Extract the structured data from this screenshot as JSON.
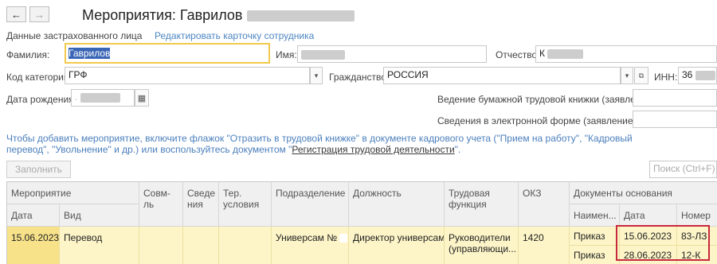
{
  "window": {
    "title": "Мероприятия: Гаврилов"
  },
  "nav": {
    "back": "←",
    "forward": "→"
  },
  "section": {
    "insured_label": "Данные застрахованного лица",
    "edit_link": "Редактировать карточку сотрудника"
  },
  "form": {
    "surname_label": "Фамилия:",
    "surname_value": "Гаврилов",
    "name_label": "Имя:",
    "patronymic_label": "Отчество:",
    "patronymic_value": "К",
    "category_label": "Код категории:",
    "category_value": "ГРФ",
    "citizenship_label": "Гражданство:",
    "citizenship_value": "РОССИЯ",
    "inn_label": "ИНН:",
    "inn_value": "36",
    "birth_label": "Дата рождения:",
    "paper_book_label": "Ведение бумажной трудовой книжки (заявление):",
    "electronic_label": "Сведения в электронной форме (заявление):"
  },
  "info": {
    "text": "Чтобы добавить мероприятие, включите флажок \"Отразить в трудовой книжке\" в документе кадрового учета (\"Прием на работу\", \"Кадровый перевод\", \"Увольнение\" и др.) или воспользуйтесь документом \"",
    "link": "Регистрация трудовой деятельности",
    "tail": "\"."
  },
  "toolbar": {
    "fill_button": "Заполнить",
    "search_placeholder": "Поиск (Ctrl+F)"
  },
  "table": {
    "headers": {
      "event": "Мероприятие",
      "date": "Дата",
      "kind": "Вид",
      "combined": "Совм-ль",
      "info": "Сведе ния",
      "lost": "Тер. условия",
      "division": "Подразделение",
      "position": "Должность",
      "function": "Трудовая функция",
      "okz": "ОКЗ",
      "docs": "Документы основания",
      "doc_name": "Наимен...",
      "doc_date": "Дата",
      "doc_number": "Номер"
    },
    "row": {
      "date": "15.06.2023",
      "kind": "Перевод",
      "division": "Универсам №",
      "position": "Директор универсама",
      "function": "Руководители (управляющи...",
      "okz": "1420",
      "docs": [
        {
          "name": "Приказ",
          "date": "15.06.2023",
          "number": "83-ЛЗ"
        },
        {
          "name": "Приказ",
          "date": "28.06.2023",
          "number": "12-К"
        }
      ]
    }
  }
}
